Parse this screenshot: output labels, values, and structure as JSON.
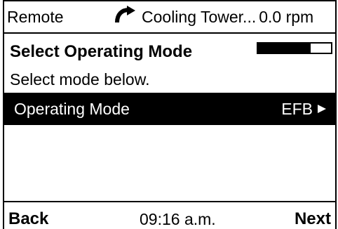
{
  "status_bar": {
    "control_location": "Remote",
    "device_name": "Cooling Tower...",
    "speed": "0.0 rpm",
    "direction_icon": "forward-rotation-arrow-icon"
  },
  "screen": {
    "title": "Select Operating Mode",
    "instruction": "Select mode below.",
    "step_progress": {
      "value": 0.72,
      "color": "#000000"
    },
    "selected_item": {
      "label": "Operating Mode",
      "value": "EFB",
      "indicator_icon": "right-triangle-icon"
    }
  },
  "footer": {
    "left_button": "Back",
    "time": "09:16 a.m.",
    "right_button": "Next"
  },
  "colors": {
    "background": "#ffffff",
    "text": "#000000",
    "selection_background": "#000000",
    "selection_text": "#ffffff"
  }
}
